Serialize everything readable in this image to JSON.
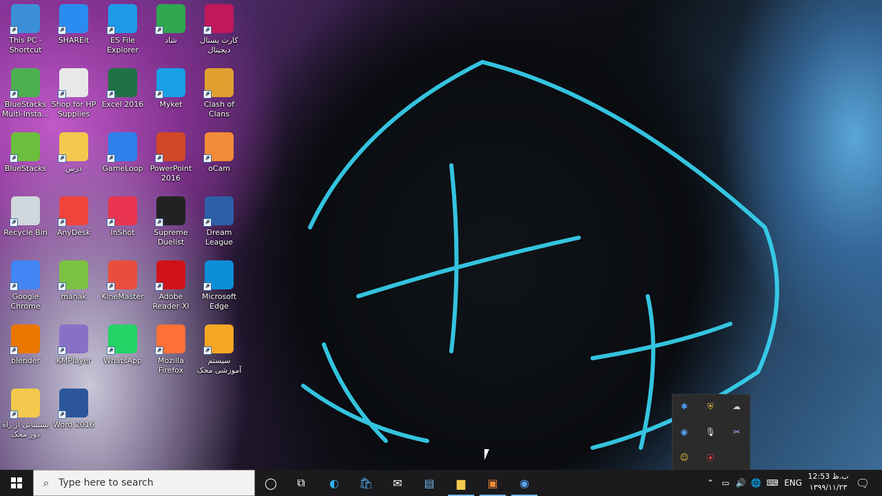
{
  "desktop": {
    "icons": [
      {
        "label": "This PC - Shortcut",
        "icon": "computer-icon",
        "color": "#3b8fd9"
      },
      {
        "label": "SHAREit",
        "icon": "shareit-icon",
        "color": "#2a8cf0"
      },
      {
        "label": "ES File Explorer",
        "icon": "folder-icon",
        "color": "#1e9be8"
      },
      {
        "label": "شاد",
        "icon": "shad-app-icon",
        "color": "#2fa84f"
      },
      {
        "label": "کارت پستال دیجیتال",
        "icon": "postcard-icon",
        "color": "#c2185b"
      },
      {
        "label": "BlueStacks Multi-Insta...",
        "icon": "bluestacks-multi-icon",
        "color": "#4caf50"
      },
      {
        "label": "Shop for HP Supplies",
        "icon": "printer-icon",
        "color": "#e8e8e8"
      },
      {
        "label": "Excel 2016",
        "icon": "excel-icon",
        "color": "#1f7244"
      },
      {
        "label": "Myket",
        "icon": "myket-icon",
        "color": "#1aa0e8"
      },
      {
        "label": "Clash of Clans",
        "icon": "clash-of-clans-icon",
        "color": "#e0a030"
      },
      {
        "label": "BlueStacks",
        "icon": "bluestacks-icon",
        "color": "#6cbf3c"
      },
      {
        "label": "درس",
        "icon": "folder-yellow-icon",
        "color": "#f2c94c"
      },
      {
        "label": "GameLoop",
        "icon": "gameloop-icon",
        "color": "#2f80ed"
      },
      {
        "label": "PowerPoint 2016",
        "icon": "powerpoint-icon",
        "color": "#d24726"
      },
      {
        "label": "oCam",
        "icon": "ocam-icon",
        "color": "#f28c38"
      },
      {
        "label": "Recycle Bin",
        "icon": "recycle-bin-icon",
        "color": "#cfd8dc"
      },
      {
        "label": "AnyDesk",
        "icon": "anydesk-icon",
        "color": "#ef443b"
      },
      {
        "label": "InShot",
        "icon": "inshot-icon",
        "color": "#e8344e"
      },
      {
        "label": "Supreme Duelist",
        "icon": "supreme-duelist-icon",
        "color": "#222222"
      },
      {
        "label": "Dream League",
        "icon": "dream-league-icon",
        "color": "#2d5fa8"
      },
      {
        "label": "Google Chrome",
        "icon": "chrome-icon",
        "color": "#4285f4"
      },
      {
        "label": "mahak",
        "icon": "mahak-icon",
        "color": "#7cc242"
      },
      {
        "label": "KineMaster",
        "icon": "kinemaster-icon",
        "color": "#e94e3c"
      },
      {
        "label": "Adobe Reader XI",
        "icon": "adobe-reader-icon",
        "color": "#d0121b"
      },
      {
        "label": "Microsoft Edge",
        "icon": "edge-icon",
        "color": "#0f8ed8"
      },
      {
        "label": "blender",
        "icon": "blender-icon",
        "color": "#ea7600"
      },
      {
        "label": "KMPlayer",
        "icon": "kmplayer-icon",
        "color": "#8a6fc7"
      },
      {
        "label": "WhatsApp",
        "icon": "whatsapp-icon",
        "color": "#25d366"
      },
      {
        "label": "Mozilla Firefox",
        "icon": "firefox-icon",
        "color": "#ff7139"
      },
      {
        "label": "سیستم آموزشی محک",
        "icon": "lightbulb-icon",
        "color": "#f5a623"
      },
      {
        "label": "پشتیبانی از راه دور محک",
        "icon": "folder-remote-icon",
        "color": "#f2c94c"
      },
      {
        "label": "Word 2016",
        "icon": "word-icon",
        "color": "#2b579a"
      }
    ]
  },
  "tray_popup": {
    "icons": [
      "bluetooth-icon",
      "security-shield-icon",
      "cloud-offline-icon",
      "gameloop-tray-icon",
      "microphone-icon",
      "network-tool-icon",
      "emoji-icon",
      "record-icon"
    ]
  },
  "taskbar": {
    "search_placeholder": "Type here to search",
    "apps": [
      "cortana-icon",
      "task-view-icon",
      "edge-icon",
      "store-icon",
      "mail-icon",
      "desktop-shortcut-icon",
      "file-explorer-icon",
      "ocam-icon",
      "gameloop-icon"
    ],
    "language": "ENG",
    "time": "12:53 ب.ظ",
    "date": "۱۳۹۹/۱۱/۲۳"
  }
}
